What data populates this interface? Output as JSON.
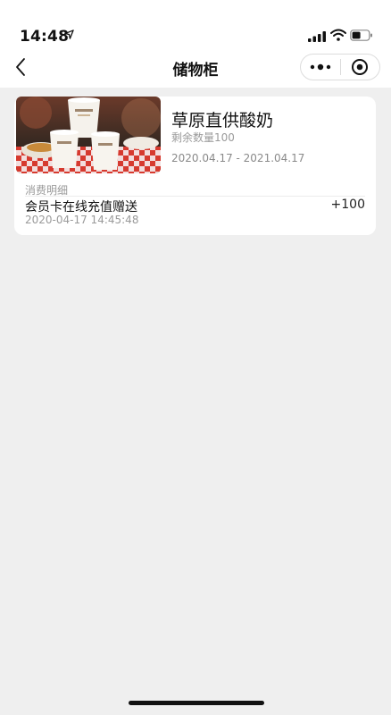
{
  "status_bar": {
    "time": "14:48",
    "icons": [
      "location-arrow-icon",
      "cellular-signal-icon",
      "wifi-icon",
      "battery-icon"
    ]
  },
  "nav": {
    "title": "储物柜",
    "back_icon": "chevron-left-icon",
    "more_icon": "more-dots-icon",
    "close_icon": "target-close-icon"
  },
  "locker_item": {
    "product_name": "草原直供酸奶",
    "remaining": "剩余数量100",
    "validity": "2020.04.17 - 2021.04.17",
    "detail_label": "消费明细",
    "records": [
      {
        "title": "会员卡在线充值赠送",
        "amount": "+100",
        "time": "2020-04-17 14:45:48"
      }
    ]
  },
  "colors": {
    "page_background": "#efefef",
    "card_background": "#ffffff",
    "muted_text": "#9a9a9a"
  }
}
